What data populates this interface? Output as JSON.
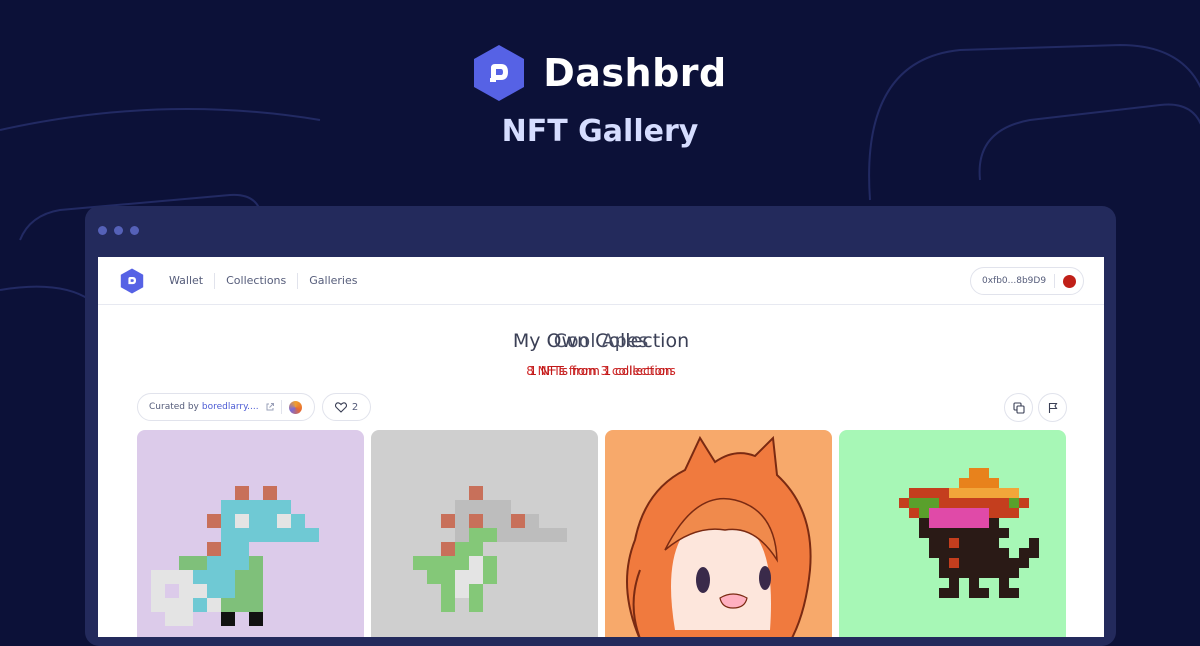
{
  "brand": {
    "name": "Dashbrd",
    "tagline": "NFT Gallery",
    "logo_icon": "dashbrd-logo-icon",
    "accent": "#5662e5"
  },
  "nav": {
    "items": [
      {
        "label": "Wallet"
      },
      {
        "label": "Collections"
      },
      {
        "label": "Galleries"
      }
    ]
  },
  "wallet": {
    "address": "0xfb0...8b9D9"
  },
  "gallery": {
    "title": "My Own Collection",
    "title_overlay": "Cool Apes",
    "subtitle": "8 NFTs from 3 collections",
    "subtitle_overlay": "1 NFTs from 1 collection",
    "curated_label": "Curated by",
    "curated_user": "boredlarry....",
    "likes": "2"
  },
  "nfts": [
    {
      "name": "Pixel dino lilac",
      "background": "#dccbea"
    },
    {
      "name": "Pixel dino grey",
      "background": "#cfcfcf"
    },
    {
      "name": "Anime fox girl",
      "background": "#f7a96b"
    },
    {
      "name": "Sombrero dino",
      "background": "#a7f7b6"
    }
  ]
}
